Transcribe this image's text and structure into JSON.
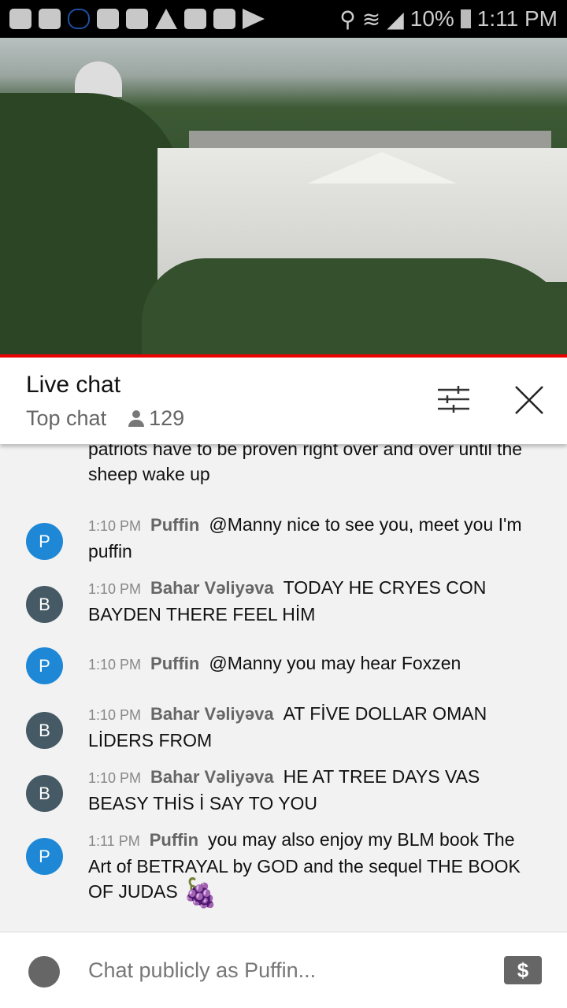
{
  "status_bar": {
    "battery": "10%",
    "time": "1:11 PM",
    "icons": [
      "youtube-icon",
      "m-app-icon",
      "cloud-icon",
      "crown-icon",
      "folder-icon",
      "warning-icon",
      "image-icon",
      "shopping-bag-icon",
      "play-store-icon",
      "location-icon",
      "wifi-icon",
      "signal-icon",
      "battery-icon"
    ]
  },
  "colors": {
    "accent_red": "#ee0000",
    "avatar_p": "#1e88d6",
    "avatar_b": "#455a64"
  },
  "chat_header": {
    "title": "Live chat",
    "mode": "Top chat",
    "viewers": "129"
  },
  "messages": [
    {
      "text": "mandates covid passports. How many times do the patriots have to be proven right over and over until the sheep wake up"
    },
    {
      "avatar": "P",
      "time": "1:10 PM",
      "author": "Puffin",
      "text": "@Manny nice to see you, meet you I'm puffin"
    },
    {
      "avatar": "B",
      "time": "1:10 PM",
      "author": "Bahar Vəliyəva",
      "text": "TODAY HE CRYES CON BAYDEN THERE FEEL HİM"
    },
    {
      "avatar": "P",
      "time": "1:10 PM",
      "author": "Puffin",
      "text": "@Manny you may hear Foxzen"
    },
    {
      "avatar": "B",
      "time": "1:10 PM",
      "author": "Bahar Vəliyəva",
      "text": "AT FİVE DOLLAR OMAN LİDERS FROM"
    },
    {
      "avatar": "B",
      "time": "1:10 PM",
      "author": "Bahar Vəliyəva",
      "text": "HE AT TREE DAYS VAS BEASY THİS İ SAY TO YOU"
    },
    {
      "avatar": "P",
      "time": "1:11 PM",
      "author": "Puffin",
      "text": "you may also enjoy my BLM book The Art of BETRAYAL by GOD and the sequel THE BOOK OF JUDAS",
      "emoji": "🍇"
    }
  ],
  "footer": {
    "placeholder": "Chat publicly as Puffin...",
    "dollar": "$"
  }
}
